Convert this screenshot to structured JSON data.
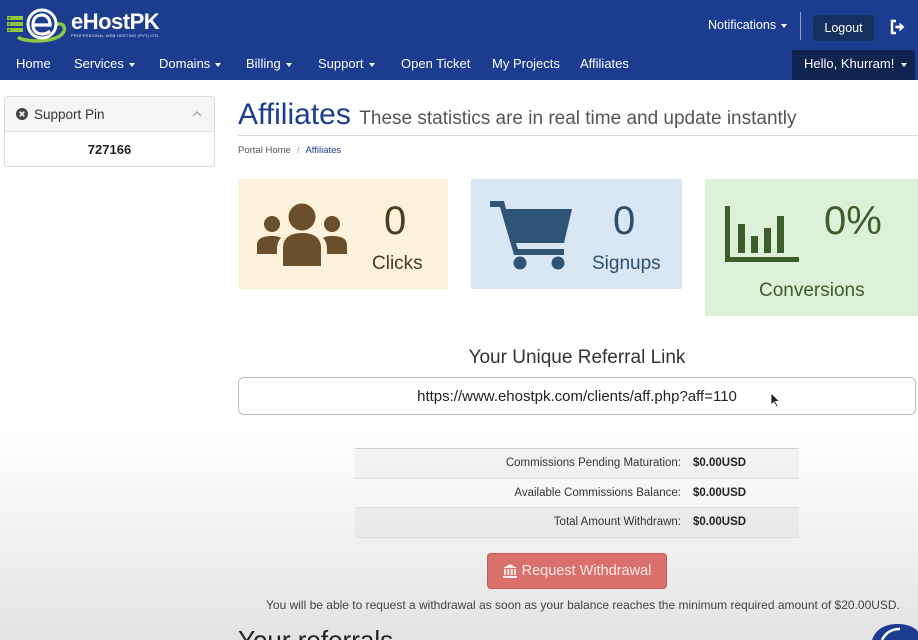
{
  "brand": {
    "name": "eHostPK",
    "tagline": "PROFESSIONAL WEB HOSTING (PVT) LTD.",
    "colors": {
      "header": "#1c3d8f",
      "accent_green": "#8dc63f"
    }
  },
  "header": {
    "notifications_label": "Notifications",
    "logout_label": "Logout",
    "exit_icon": "sign-out-icon",
    "greeting": "Hello, Khurram!"
  },
  "nav": {
    "items": [
      {
        "label": "Home"
      },
      {
        "label": "Services"
      },
      {
        "label": "Domains"
      },
      {
        "label": "Billing"
      },
      {
        "label": "Support"
      },
      {
        "label": "Open Ticket"
      },
      {
        "label": "My Projects"
      },
      {
        "label": "Affiliates"
      }
    ]
  },
  "sidebar": {
    "support_pin": {
      "title": "Support Pin",
      "value": "727166"
    }
  },
  "page": {
    "title": "Affiliates",
    "subtitle": "These statistics are in real time and update instantly",
    "breadcrumb": {
      "home": "Portal Home",
      "current": "Affiliates"
    }
  },
  "tiles": [
    {
      "value": "0",
      "label": "Clicks",
      "icon": "users-icon",
      "color": "#fcf2dc"
    },
    {
      "value": "0",
      "label": "Signups",
      "icon": "shopping-cart-icon",
      "color": "#d9e7f5"
    },
    {
      "value": "0%",
      "label": "Conversions",
      "icon": "bar-chart-icon",
      "color": "#dff0d8"
    }
  ],
  "referral": {
    "heading": "Your Unique Referral Link",
    "url": "https://www.ehostpk.com/clients/aff.php?aff=110"
  },
  "commissions": [
    {
      "label": "Commissions Pending Maturation:",
      "value": "$0.00USD"
    },
    {
      "label": "Available Commissions Balance:",
      "value": "$0.00USD"
    },
    {
      "label": "Total Amount Withdrawn:",
      "value": "$0.00USD"
    }
  ],
  "withdraw": {
    "button_label": "Request Withdrawal",
    "note": "You will be able to request a withdrawal as soon as your balance reaches the minimum required amount of $20.00USD."
  },
  "referrals_heading": "Your referrals"
}
